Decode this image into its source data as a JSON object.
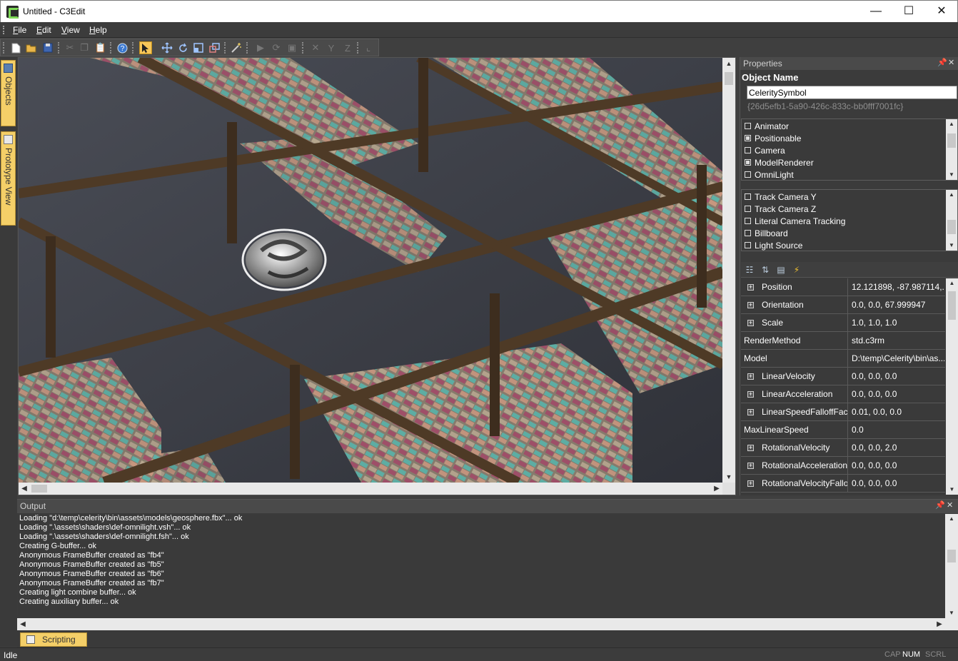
{
  "window": {
    "title": "Untitled - C3Edit",
    "minimize": "—",
    "maximize": "☐",
    "close": "✕"
  },
  "menu": [
    {
      "label": "File",
      "u": "F",
      "rest": "ile"
    },
    {
      "label": "Edit",
      "u": "E",
      "rest": "dit"
    },
    {
      "label": "View",
      "u": "V",
      "rest": "iew"
    },
    {
      "label": "Help",
      "u": "H",
      "rest": "elp"
    }
  ],
  "toolbar": {
    "icons": [
      "new-file-icon",
      "open-folder-icon",
      "save-icon",
      "cut-icon",
      "copy-icon",
      "paste-icon",
      "help-icon",
      "select-arrow-icon",
      "move-icon",
      "rotate-icon",
      "scale-icon",
      "scale-nonuniform-icon",
      "magic-wand-icon",
      "play-icon",
      "stop-icon",
      "pause-icon",
      "x-axis-icon",
      "y-axis-icon",
      "z-axis-icon",
      "snap-icon"
    ]
  },
  "left_tabs": {
    "objects": "Objects",
    "prototype": "Prototype View"
  },
  "properties": {
    "header": "Properties",
    "object_name_label": "Object Name",
    "object_name_value": "CeleritySymbol",
    "guid": "{26d5efb1-5a90-426c-833c-bb0fff7001fc}",
    "components": [
      {
        "label": "Animator",
        "checked": false
      },
      {
        "label": "Positionable",
        "checked": true
      },
      {
        "label": "Camera",
        "checked": false
      },
      {
        "label": "ModelRenderer",
        "checked": true
      },
      {
        "label": "OmniLight",
        "checked": false
      }
    ],
    "flags": [
      {
        "label": "Track Camera Y",
        "checked": false
      },
      {
        "label": "Track Camera Z",
        "checked": false
      },
      {
        "label": "Literal Camera Tracking",
        "checked": false
      },
      {
        "label": "Billboard",
        "checked": false
      },
      {
        "label": "Light Source",
        "checked": false
      }
    ],
    "rows": [
      {
        "name": "Position",
        "value": "12.121898, -87.987114,...",
        "expandable": true
      },
      {
        "name": "Orientation",
        "value": "0.0, 0.0, 67.999947",
        "expandable": true
      },
      {
        "name": "Scale",
        "value": "1.0, 1.0, 1.0",
        "expandable": true
      },
      {
        "name": "RenderMethod",
        "value": "std.c3rm",
        "expandable": false
      },
      {
        "name": "Model",
        "value": "D:\\temp\\Celerity\\bin\\as...",
        "expandable": false
      },
      {
        "name": "LinearVelocity",
        "value": "0.0, 0.0, 0.0",
        "expandable": true
      },
      {
        "name": "LinearAcceleration",
        "value": "0.0, 0.0, 0.0",
        "expandable": true
      },
      {
        "name": "LinearSpeedFalloffFac...",
        "value": "0.01, 0.0, 0.0",
        "expandable": true
      },
      {
        "name": "MaxLinearSpeed",
        "value": "0.0",
        "expandable": false
      },
      {
        "name": "RotationalVelocity",
        "value": "0.0, 0.0, 2.0",
        "expandable": true
      },
      {
        "name": "RotationalAcceleration",
        "value": "0.0, 0.0, 0.0",
        "expandable": true
      },
      {
        "name": "RotationalVelocityFallo...",
        "value": "0.0, 0.0, 0.0",
        "expandable": true
      }
    ]
  },
  "output": {
    "header": "Output",
    "lines": [
      "Loading \"d:\\temp\\celerity\\bin\\assets\\models\\geosphere.fbx\"... ok",
      "Loading \".\\assets\\shaders\\def-omnilight.vsh\"... ok",
      "Loading \".\\assets\\shaders\\def-omnilight.fsh\"... ok",
      "Creating G-buffer... ok",
      "Anonymous FrameBuffer created as \"fb4\"",
      "Anonymous FrameBuffer created as \"fb5\"",
      "Anonymous FrameBuffer created as \"fb6\"",
      "Anonymous FrameBuffer created as \"fb7\"",
      "Creating light combine buffer... ok",
      "Creating auxiliary buffer... ok"
    ]
  },
  "bottom_tabs": {
    "scripting": "Scripting"
  },
  "status": {
    "text": "Idle",
    "cap": "CAP",
    "num": "NUM",
    "scrl": "SCRL"
  }
}
